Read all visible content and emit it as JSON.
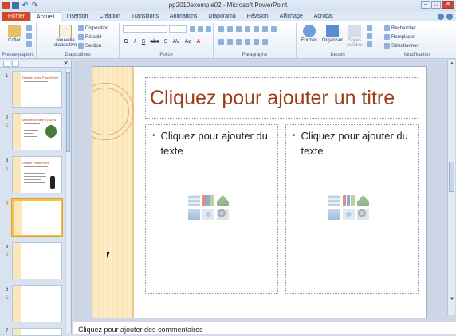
{
  "window": {
    "title": "pp2010exemple02 - Microsoft PowerPoint",
    "controls": [
      "–",
      "□",
      "✕"
    ]
  },
  "tabs": [
    {
      "label": "Fichier"
    },
    {
      "label": "Accueil"
    },
    {
      "label": "Insertion"
    },
    {
      "label": "Création"
    },
    {
      "label": "Transitions"
    },
    {
      "label": "Animations"
    },
    {
      "label": "Diaporama"
    },
    {
      "label": "Révision"
    },
    {
      "label": "Affichage"
    },
    {
      "label": "Acrobat"
    }
  ],
  "ribbon": {
    "clipboard": {
      "paste": "Coller",
      "label": "Presse-papiers"
    },
    "slides": {
      "new_slide_line1": "Nouvelle",
      "new_slide_line2": "diapositive",
      "layout": "Disposition",
      "reset": "Rétablir",
      "section": "Section",
      "label": "Diapositives"
    },
    "font": {
      "bold": "G",
      "italic": "I",
      "underline": "S",
      "strike": "abc",
      "shadow": "S",
      "spacing": "AV",
      "case": "Aa",
      "color": "A",
      "label": "Police"
    },
    "paragraph": {
      "label": "Paragraphe"
    },
    "drawing": {
      "shapes": "Formes",
      "arrange": "Organiser",
      "quick_styles_line1": "Styles",
      "quick_styles_line2": "rapides",
      "label": "Dessin"
    },
    "editing": {
      "find": "Rechercher",
      "replace": "Remplacer",
      "select": "Sélectionner",
      "label": "Modification"
    }
  },
  "thumbnails": [
    {
      "num": "1",
      "title": "Débuter avec PowerPoint"
    },
    {
      "num": "2",
      "title": "Modèle de liste à puces"
    },
    {
      "num": "3",
      "title": "Utiliser PowerPoint"
    },
    {
      "num": "4",
      "title": ""
    },
    {
      "num": "5",
      "title": ""
    },
    {
      "num": "6",
      "title": ""
    },
    {
      "num": "7",
      "title": ""
    }
  ],
  "slide": {
    "title_placeholder": "Cliquez pour ajouter un titre",
    "left_body": "Cliquez pour ajouter du texte",
    "right_body": "Cliquez pour ajouter du texte"
  },
  "notes": {
    "placeholder": "Cliquez pour ajouter des commentaires"
  },
  "colors": {
    "accent": "#d24726",
    "title_color": "#9c3d1a",
    "selection": "#f5c34a"
  }
}
